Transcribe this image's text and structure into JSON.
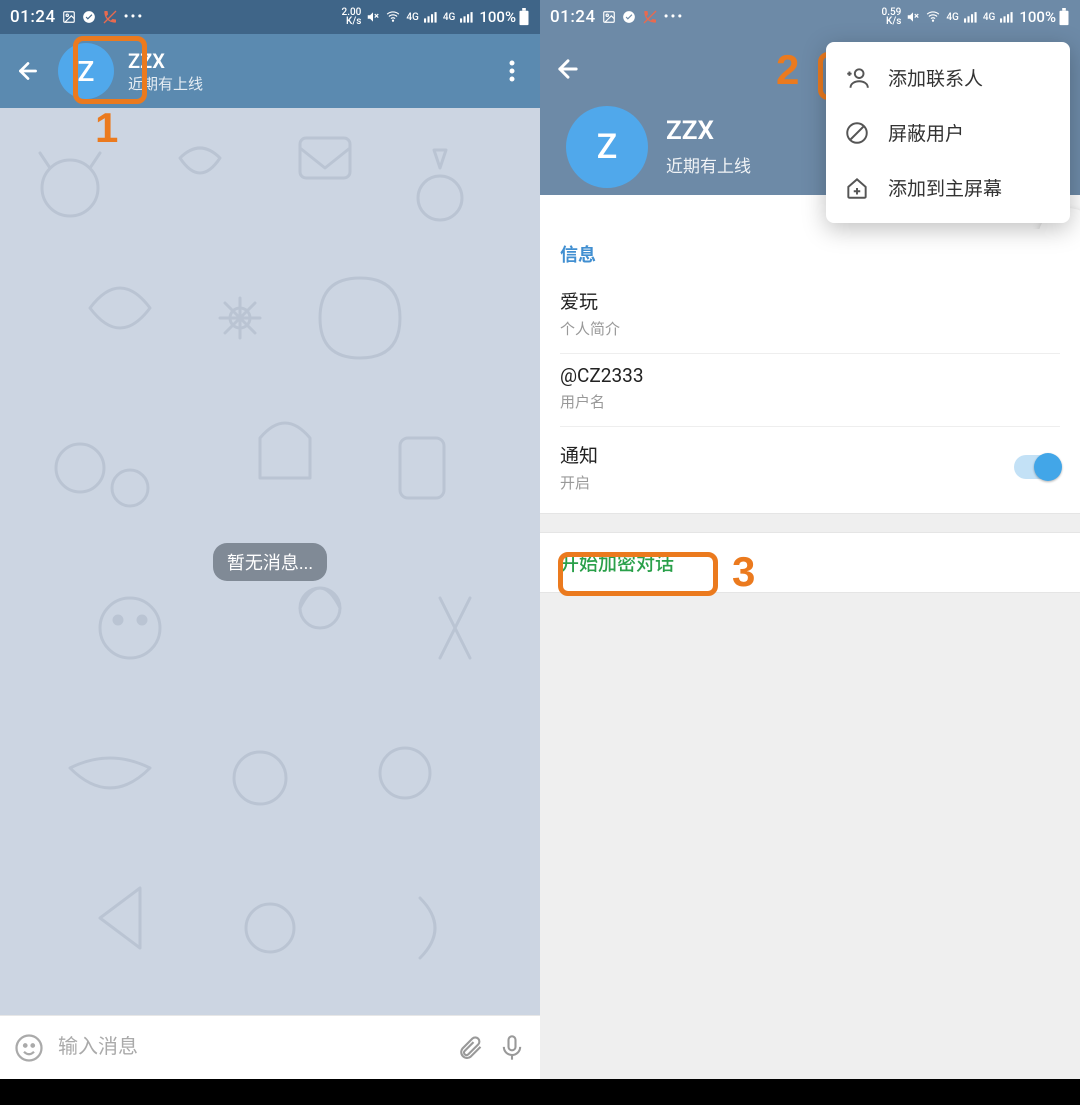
{
  "statusbar": {
    "time": "01:24",
    "net_left": "2.00",
    "net_left_unit": "K/s",
    "net_right": "0.59",
    "net_right_unit": "K/s",
    "sig_label": "4G",
    "battery_pct": "100%",
    "dots": "•••"
  },
  "chat": {
    "avatar_letter": "Z",
    "name": "ZZX",
    "subtitle": "近期有上线",
    "empty_msg": "暂无消息...",
    "input_placeholder": "输入消息"
  },
  "profile": {
    "avatar_letter": "Z",
    "name": "ZZX",
    "subtitle": "近期有上线",
    "section_title": "信息",
    "bio_value": "爱玩",
    "bio_label": "个人简介",
    "username_value": "@CZ2333",
    "username_label": "用户名",
    "notif_title": "通知",
    "notif_state": "开启",
    "secret_chat": "开始加密对话"
  },
  "menu": {
    "add_contact": "添加联系人",
    "block_user": "屏蔽用户",
    "add_to_home": "添加到主屏幕"
  },
  "annotations": {
    "n1": "1",
    "n2": "2",
    "n3": "3"
  }
}
